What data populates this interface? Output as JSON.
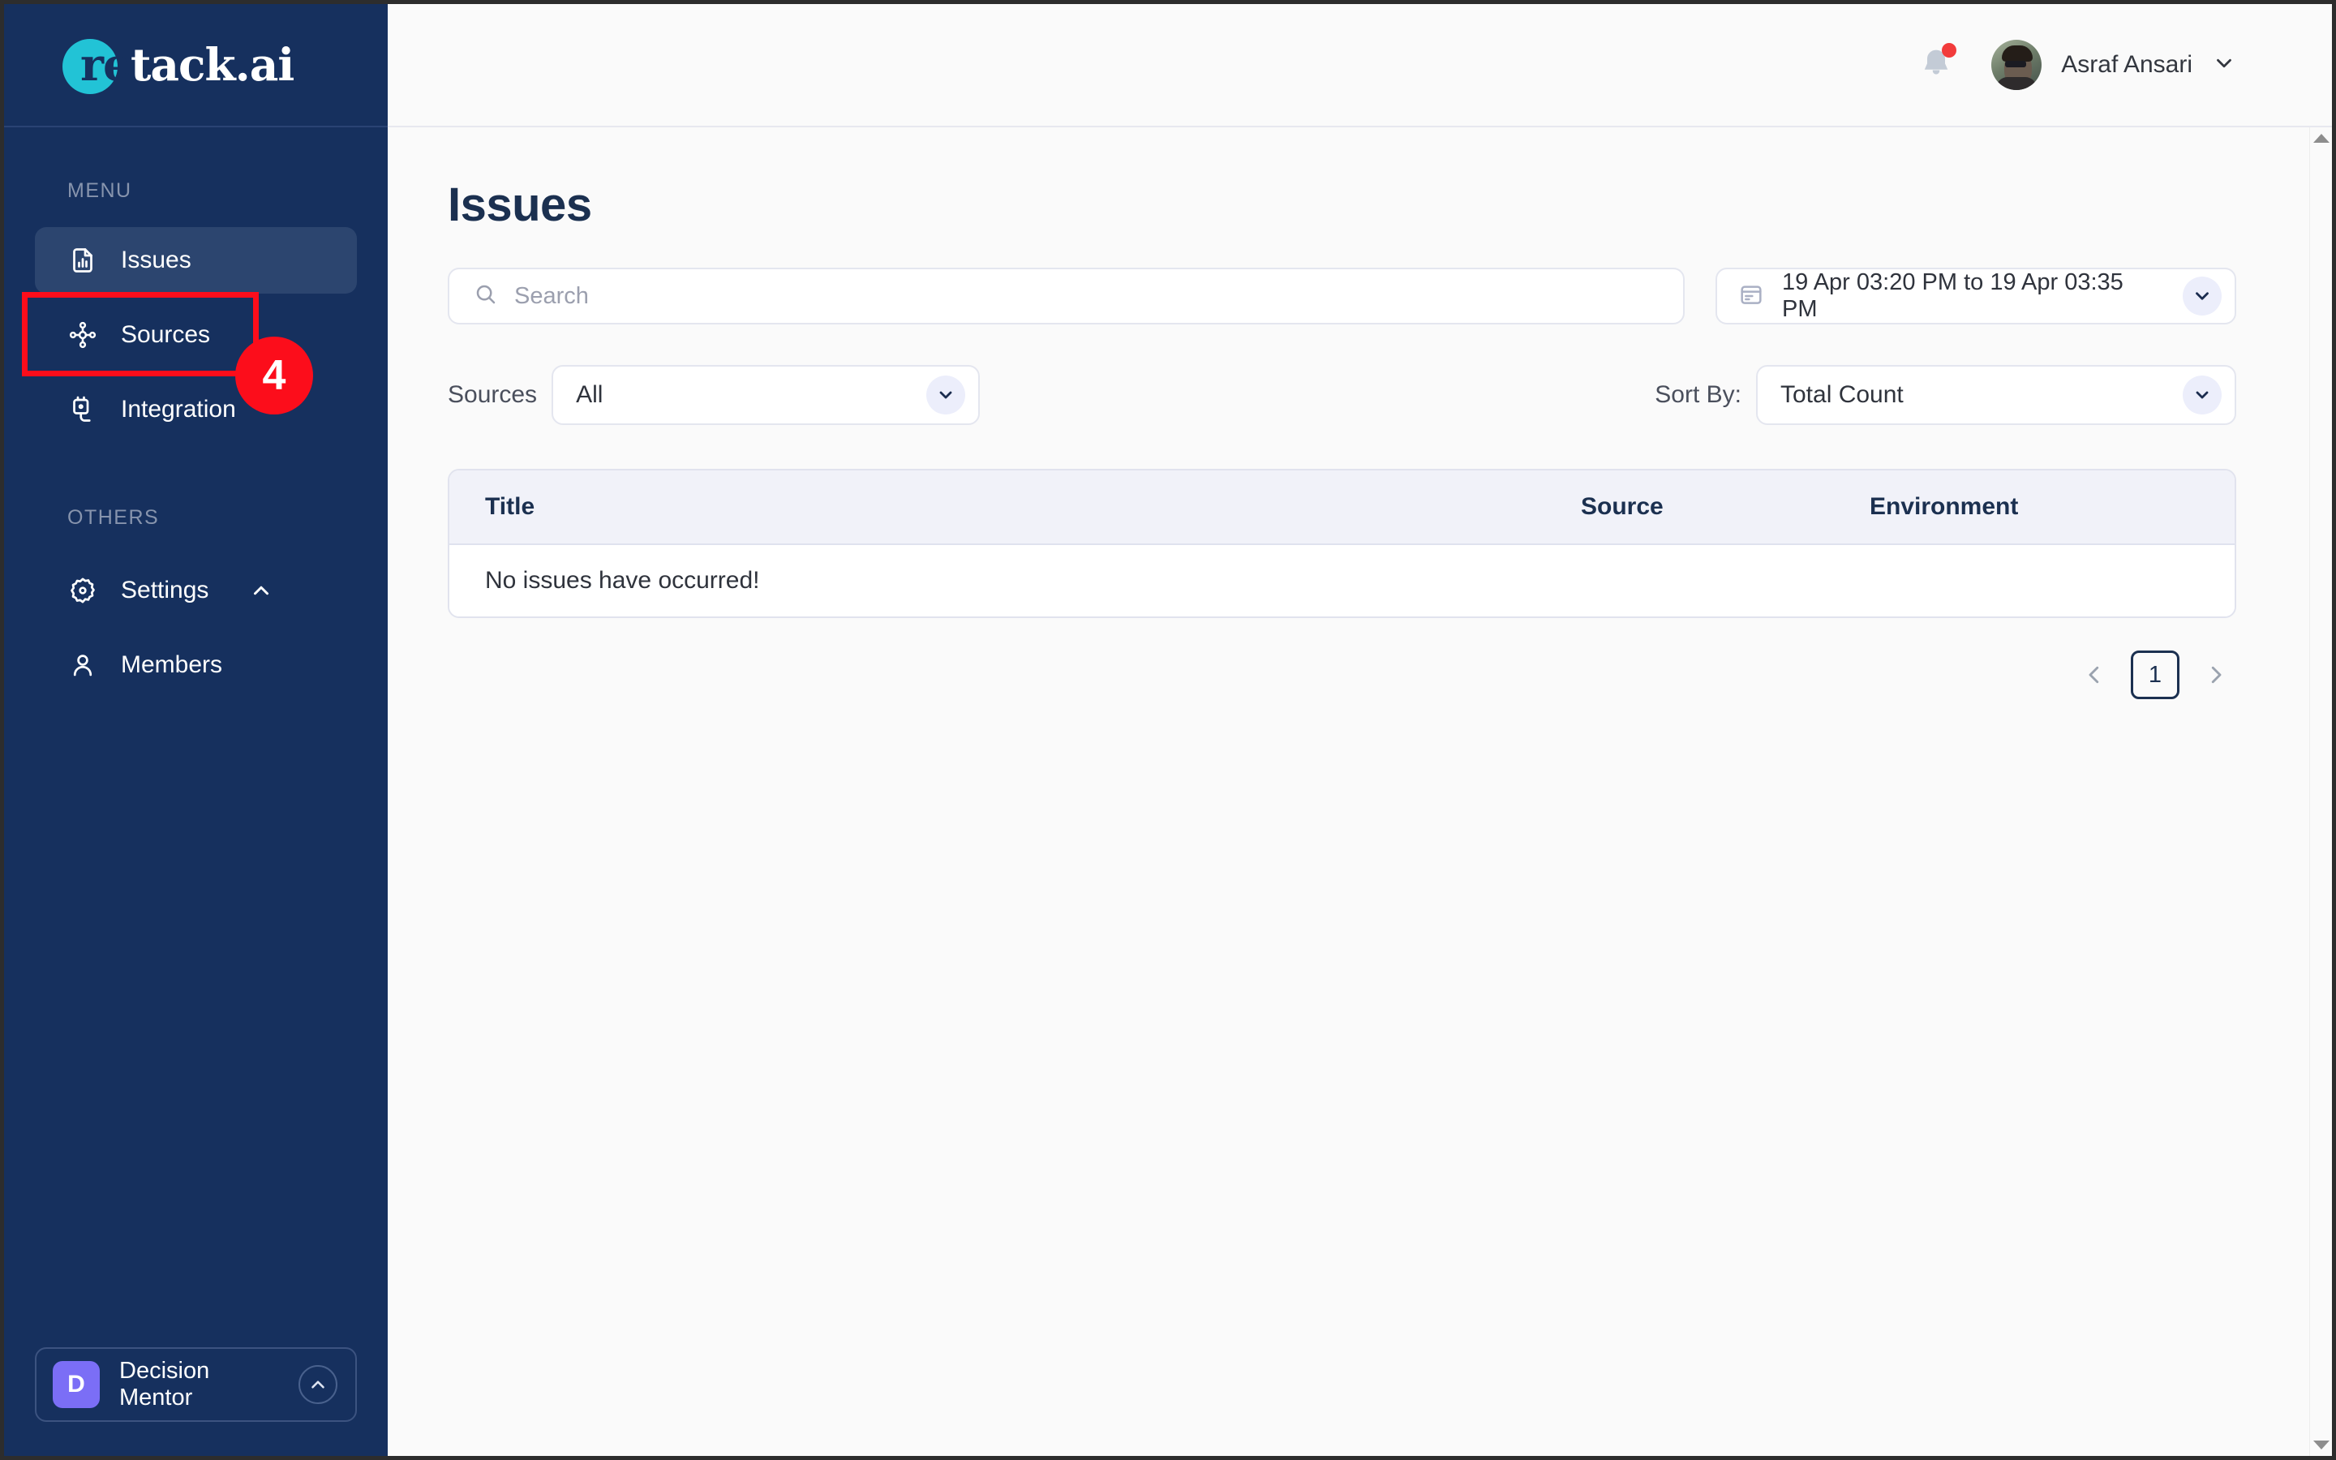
{
  "brand": {
    "logo_prefix": "re",
    "logo_suffix": "tack.ai",
    "accent_cyan": "#22c3d6",
    "sidebar_bg": "#16305e"
  },
  "sidebar": {
    "menu_section_label": "MENU",
    "others_section_label": "OTHERS",
    "menu_items": [
      {
        "label": "Issues",
        "icon": "document-chart-icon",
        "active": true
      },
      {
        "label": "Sources",
        "icon": "nodes-hub-icon",
        "active": false
      },
      {
        "label": "Integration",
        "icon": "plug-icon",
        "active": false
      }
    ],
    "other_items": [
      {
        "label": "Settings",
        "icon": "gear-icon",
        "chevron": "chevron-up-icon"
      },
      {
        "label": "Members",
        "icon": "person-icon"
      }
    ],
    "workspace": {
      "initial": "D",
      "name": "Decision Mentor",
      "toggle_icon": "chevron-up-circle-icon",
      "avatar_color": "#7b6ef6"
    }
  },
  "topbar": {
    "notification_icon": "bell-icon",
    "has_unread": true,
    "unread_color": "#f23b3b",
    "user_name": "Asraf Ansari",
    "user_chevron": "chevron-down-icon",
    "avatar_icon": "user-avatar"
  },
  "page": {
    "title": "Issues"
  },
  "search": {
    "placeholder": "Search",
    "value": "",
    "icon": "search-icon"
  },
  "date_range": {
    "icon": "calendar-icon",
    "value": "19 Apr 03:20 PM to 19 Apr 03:35 PM",
    "chevron": "chevron-down-icon"
  },
  "filters": {
    "sources": {
      "label": "Sources",
      "value": "All",
      "chevron": "chevron-down-icon"
    },
    "sort_by": {
      "label": "Sort By:",
      "value": "Total Count",
      "chevron": "chevron-down-icon"
    }
  },
  "table": {
    "columns": [
      "Title",
      "Source",
      "Environment"
    ],
    "rows": [],
    "empty_message": "No issues have occurred!"
  },
  "pagination": {
    "prev_icon": "chevron-left-icon",
    "next_icon": "chevron-right-icon",
    "current_page": "1"
  },
  "annotation": {
    "step_number": "4",
    "highlight_color": "#fc0d1b",
    "target": "Sources"
  },
  "scrollbar": {
    "up_icon": "scroll-up-arrow",
    "down_icon": "scroll-down-arrow"
  }
}
